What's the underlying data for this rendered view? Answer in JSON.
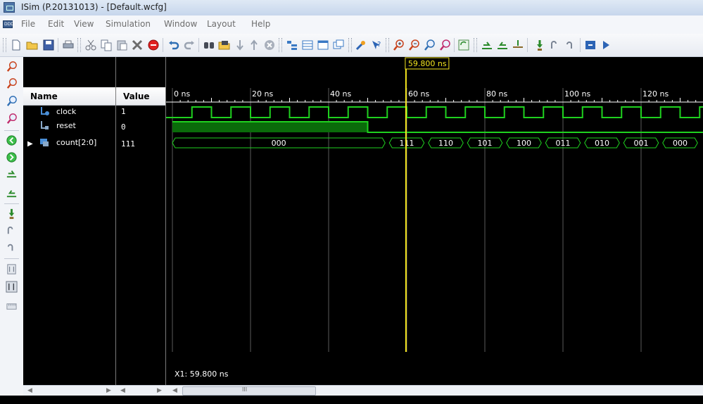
{
  "window": {
    "title": "ISim (P.20131013) - [Default.wcfg]"
  },
  "menu": [
    "File",
    "Edit",
    "View",
    "Simulation",
    "Window",
    "Layout",
    "Help"
  ],
  "toolbar_icons": [
    "new-file-icon",
    "open-folder-icon",
    "save-icon",
    "print-icon",
    "cut-icon",
    "copy-icon",
    "paste-icon",
    "delete-icon",
    "stop-icon",
    "undo-icon",
    "redo-icon",
    "find-icon",
    "find-next-icon",
    "move-down-icon",
    "move-up-icon",
    "clear-icon",
    "expand-all-icon",
    "collapse-all-icon",
    "align-icon",
    "restore-icon",
    "properties-icon",
    "help-icon",
    "zoom-in-icon",
    "zoom-out-icon",
    "zoom-fit-icon",
    "zoom-cursor-icon",
    "refresh-icon",
    "restart-icon",
    "run-all-icon",
    "run-for-icon",
    "step-icon",
    "step-over-icon",
    "break-icon",
    "play-icon"
  ],
  "sidebar_icons": [
    "zoom-in-icon",
    "zoom-out-icon",
    "zoom-fit-icon",
    "zoom-cursor-icon",
    "go-start-icon",
    "go-end-icon",
    "prev-transition-icon",
    "next-transition-icon",
    "add-marker-icon",
    "prev-marker-icon",
    "next-marker-icon",
    "swap-cursor-icon",
    "snap-icon",
    "floating-ruler-icon"
  ],
  "panels": {
    "name_header": "Name",
    "value_header": "Value"
  },
  "signals": [
    {
      "name": "clock",
      "value": "1",
      "icon": "signal-clock-icon"
    },
    {
      "name": "reset",
      "value": "0",
      "icon": "signal-reset-icon"
    },
    {
      "name": "count[2:0]",
      "value": "111",
      "icon": "bus-icon",
      "expandable": true
    }
  ],
  "timeline": {
    "ticks": [
      "0 ns",
      "20 ns",
      "40 ns",
      "60 ns",
      "80 ns",
      "100 ns",
      "120 ns"
    ],
    "cursor_label": "59.800 ns",
    "cursor_time_ns": 59.8,
    "visible_range_ns": [
      0,
      136
    ]
  },
  "waveforms": {
    "clock_period_ns": 10,
    "clock_first_rise_ns": 5,
    "reset_high_until_ns": 50,
    "bus_segments": [
      {
        "start": 0,
        "end": 55,
        "value": "000"
      },
      {
        "start": 55,
        "end": 65,
        "value": "111"
      },
      {
        "start": 65,
        "end": 75,
        "value": "110"
      },
      {
        "start": 75,
        "end": 85,
        "value": "101"
      },
      {
        "start": 85,
        "end": 95,
        "value": "100"
      },
      {
        "start": 95,
        "end": 105,
        "value": "011"
      },
      {
        "start": 105,
        "end": 115,
        "value": "010"
      },
      {
        "start": 115,
        "end": 125,
        "value": "001"
      },
      {
        "start": 125,
        "end": 135,
        "value": "000"
      }
    ]
  },
  "status": {
    "cursor_readout": "X1: 59.800 ns",
    "scroll_thumb": "III"
  },
  "colors": {
    "wave": "#1fd11f",
    "wave_fill": "#0a6b0a",
    "cursor": "#f5e61e",
    "grid": "#5a5a5a",
    "accent": "#3c6ea8"
  }
}
